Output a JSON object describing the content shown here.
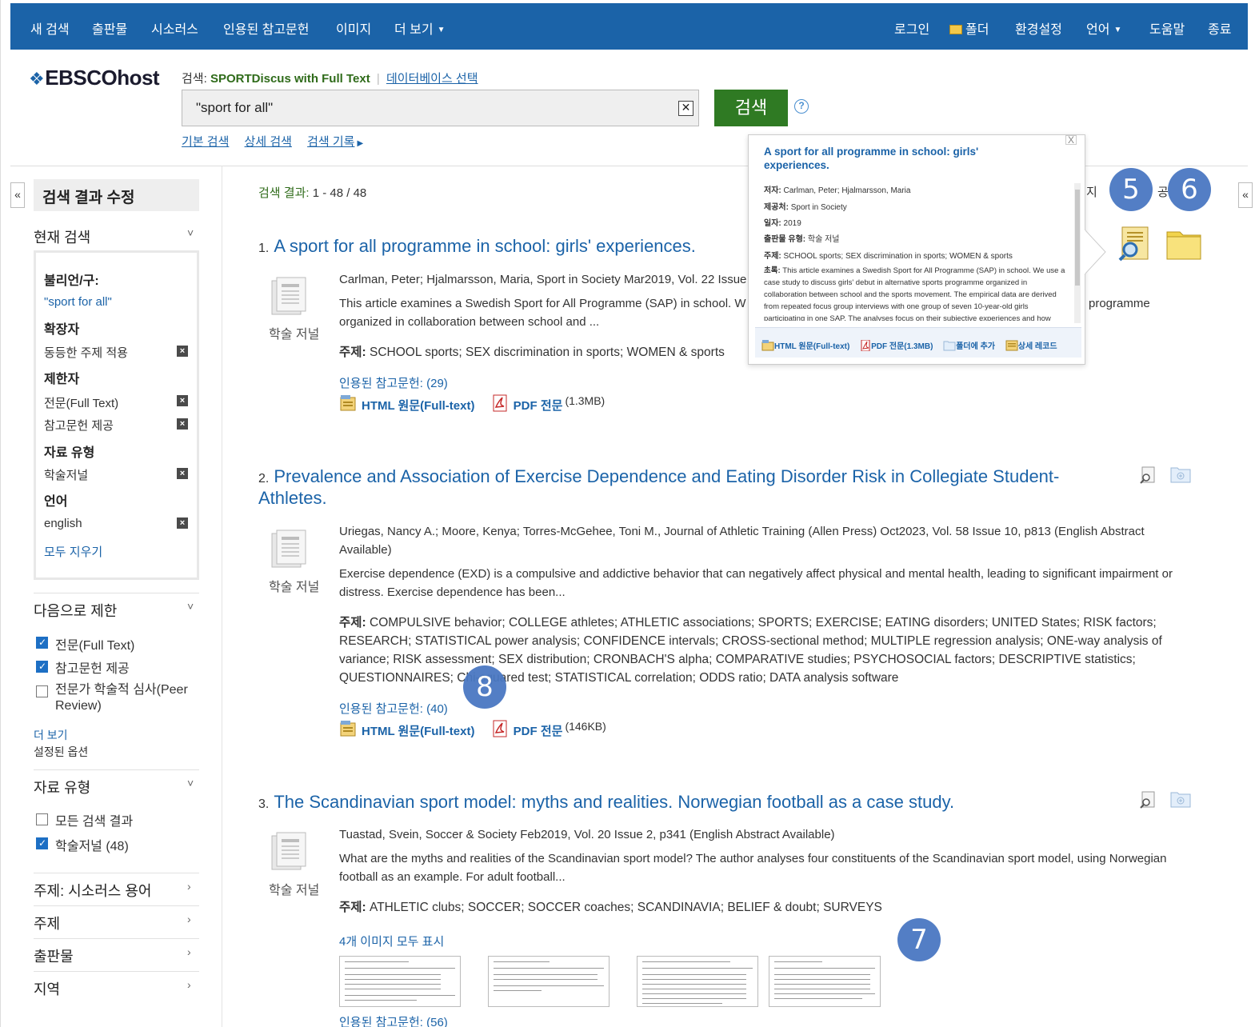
{
  "topnav": {
    "left": [
      "새 검색",
      "출판물",
      "시소러스",
      "인용된 참고문헌",
      "이미지",
      "더 보기"
    ],
    "right": [
      "로그인",
      "폴더",
      "환경설정",
      "언어",
      "도움말",
      "종료"
    ]
  },
  "header": {
    "logo": "EBSCOhost",
    "searching_label": "검색:",
    "database": "SPORTDiscus with Full Text",
    "choose_db": "데이터베이스 선택",
    "query": "\"sport for all\"",
    "search_button": "검색",
    "help": "?",
    "subnav": [
      "기본 검색",
      "상세 검색",
      "검색 기록"
    ]
  },
  "sidebar": {
    "title": "검색 결과 수정",
    "current_search": "현재 검색",
    "boolean_label": "불리언/구:",
    "boolean_value": "\"sport for all\"",
    "expanders_label": "확장자",
    "expander_item": "동등한 주제 적용",
    "limiters_label": "제한자",
    "limiter_items": [
      "전문(Full Text)",
      "참고문헌 제공"
    ],
    "source_type_label": "자료 유형",
    "source_type_item": "학술저널",
    "language_label": "언어",
    "language_item": "english",
    "clear_all": "모두 지우기",
    "limit_to": "다음으로 제한",
    "limit_options": [
      {
        "label": "전문(Full Text)",
        "checked": true
      },
      {
        "label": "참고문헌 제공",
        "checked": true
      },
      {
        "label": "전문가 학술적 심사(Peer Review)",
        "checked": false
      }
    ],
    "more": "더 보기",
    "set_options": "설정된 옵션",
    "source_types": "자료 유형",
    "source_type_options": [
      {
        "label": "모든 검색 결과",
        "checked": false
      },
      {
        "label": "학술저널 (48)",
        "checked": true
      }
    ],
    "facets": [
      "주제: 시소러스 용어",
      "주제",
      "출판물",
      "지역"
    ]
  },
  "results": {
    "count_label": "검색 결과:",
    "count_value": "1 - 48 / 48",
    "items": [
      {
        "num": "1.",
        "title": "A sport for all programme in school: girls' experiences.",
        "meta": "Carlman, Peter; Hjalmarsson, Maria, Sport in Society Mar2019, Vol. 22 Issue",
        "abstract": "This article examines a Swedish Sport for All Programme (SAP) in school. W",
        "abstract_tail": "programme",
        "abstract_line2": "organized in collaboration between school and ...",
        "subject_label": "주제:",
        "subjects": "SCHOOL sports; SEX discrimination in sports; WOMEN & sports",
        "cited": "인용된 참고문헌: (29)",
        "type": "학술 저널",
        "html": "HTML 원문(Full-text)",
        "pdf": "PDF 전문",
        "pdf_size": "(1.3MB)"
      },
      {
        "num": "2.",
        "title_l1": "Prevalence and Association of Exercise Dependence and Eating Disorder Risk in Collegiate Student-",
        "title_l2": "Athletes.",
        "meta_l1": "Uriegas, Nancy A.; Moore, Kenya; Torres-McGehee, Toni M., Journal of Athletic Training (Allen Press) Oct2023, Vol. 58 Issue 10, p813 (English Abstract",
        "meta_l2": "Available)",
        "abstract_l1": "Exercise dependence (EXD) is a compulsive and addictive behavior that can negatively affect physical and mental health, leading to significant impairment or",
        "abstract_l2": "distress. Exercise dependence has been...",
        "subject_label": "주제:",
        "subjects_l1": "COMPULSIVE behavior; COLLEGE athletes; ATHLETIC associations; SPORTS; EXERCISE; EATING disorders; UNITED States; RISK factors;",
        "subjects_l2": "RESEARCH; STATISTICAL power analysis; CONFIDENCE intervals; CROSS-sectional method; MULTIPLE regression analysis; ONE-way analysis of",
        "subjects_l3": "variance; RISK assessment; SEX distribution; CRONBACH'S alpha; COMPARATIVE studies; PSYCHOSOCIAL factors; DESCRIPTIVE statistics;",
        "subjects_l4": "QUESTIONNAIRES; Chi-squared test; STATISTICAL correlation; ODDS ratio; DATA analysis software",
        "cited": "인용된 참고문헌: (40)",
        "type": "학술 저널",
        "html": "HTML 원문(Full-text)",
        "pdf": "PDF 전문",
        "pdf_size": "(146KB)"
      },
      {
        "num": "3.",
        "title": "The Scandinavian sport model: myths and realities. Norwegian football as a case study.",
        "meta": "Tuastad, Svein, Soccer & Society Feb2019, Vol. 20 Issue 2, p341 (English Abstract Available)",
        "abstract_l1": "What are the myths and realities of the Scandinavian sport model? The author analyses four constituents of the Scandinavian sport model, using Norwegian",
        "abstract_l2": "football as an example. For adult football...",
        "subject_label": "주제:",
        "subjects": "ATHLETIC clubs; SOCCER; SOCCER coaches; SCANDINAVIA; BELIEF & doubt; SURVEYS",
        "images_link": "4개 이미지 모두 표시",
        "cited": "인용된 참고문헌: (56)",
        "type": "학술 저널"
      }
    ]
  },
  "popup": {
    "title": "A sport for all programme in school: girls' experiences.",
    "close": "X",
    "author_label": "저자:",
    "author": "Carlman, Peter; Hjalmarsson, Maria",
    "source_label": "제공처:",
    "source": "Sport in Society",
    "date_label": "일자:",
    "date": "2019",
    "pubtype_label": "출판물 유형:",
    "pubtype": "학술 저널",
    "subject_label": "주제:",
    "subject": "SCHOOL sports; SEX discrimination in sports; WOMEN & sports",
    "abstract_label": "초록:",
    "abstract": "This article examines a Swedish Sport for All Programme (SAP) in school. We use a case study to discuss girls' debut in alternative sports programme organized in collaboration between school and the sports movement. The empirical data are derived from repeated focus group interviews with one group of seven 10-year-old girls participating in one SAP. The analyses focus on their subjective experiences and how",
    "actions": [
      "HTML 원문(Full-text)",
      "PDF 전문(1.3MB)",
      "폴더에 추가",
      "상세 레코드"
    ]
  },
  "right_partial": {
    "text1": "지 ",
    "text2": "공"
  },
  "badges": [
    "5",
    "6",
    "7",
    "8"
  ]
}
